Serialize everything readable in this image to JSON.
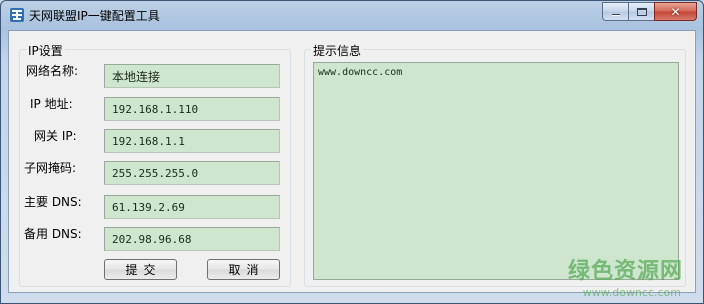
{
  "window": {
    "title": "天网联盟IP一键配置工具",
    "app_icon": "app-icon",
    "caption": {
      "minimize_icon": "minimize-icon",
      "maximize_icon": "maximize-icon",
      "close_glyph": "✕"
    }
  },
  "ip_settings": {
    "group_title": "IP设置",
    "fields": [
      {
        "label": "网络名称:",
        "value": "本地连接"
      },
      {
        "label": "IP 地址:",
        "value": "192.168.1.110"
      },
      {
        "label": "网关 IP:",
        "value": "192.168.1.1"
      },
      {
        "label": "子网掩码:",
        "value": "255.255.255.0"
      },
      {
        "label": "主要 DNS:",
        "value": "61.139.2.69"
      },
      {
        "label": "备用 DNS:",
        "value": "202.98.96.68"
      }
    ],
    "submit_label": "提交",
    "cancel_label": "取消"
  },
  "hint": {
    "group_title": "提示信息",
    "text": "www.downcc.com"
  },
  "watermark": {
    "main": "绿色资源网",
    "sub": "www.downcc.com"
  },
  "colors": {
    "input_bg": "#cde6cd",
    "close_button": "#c44637",
    "watermark": "#5aaa5a"
  }
}
